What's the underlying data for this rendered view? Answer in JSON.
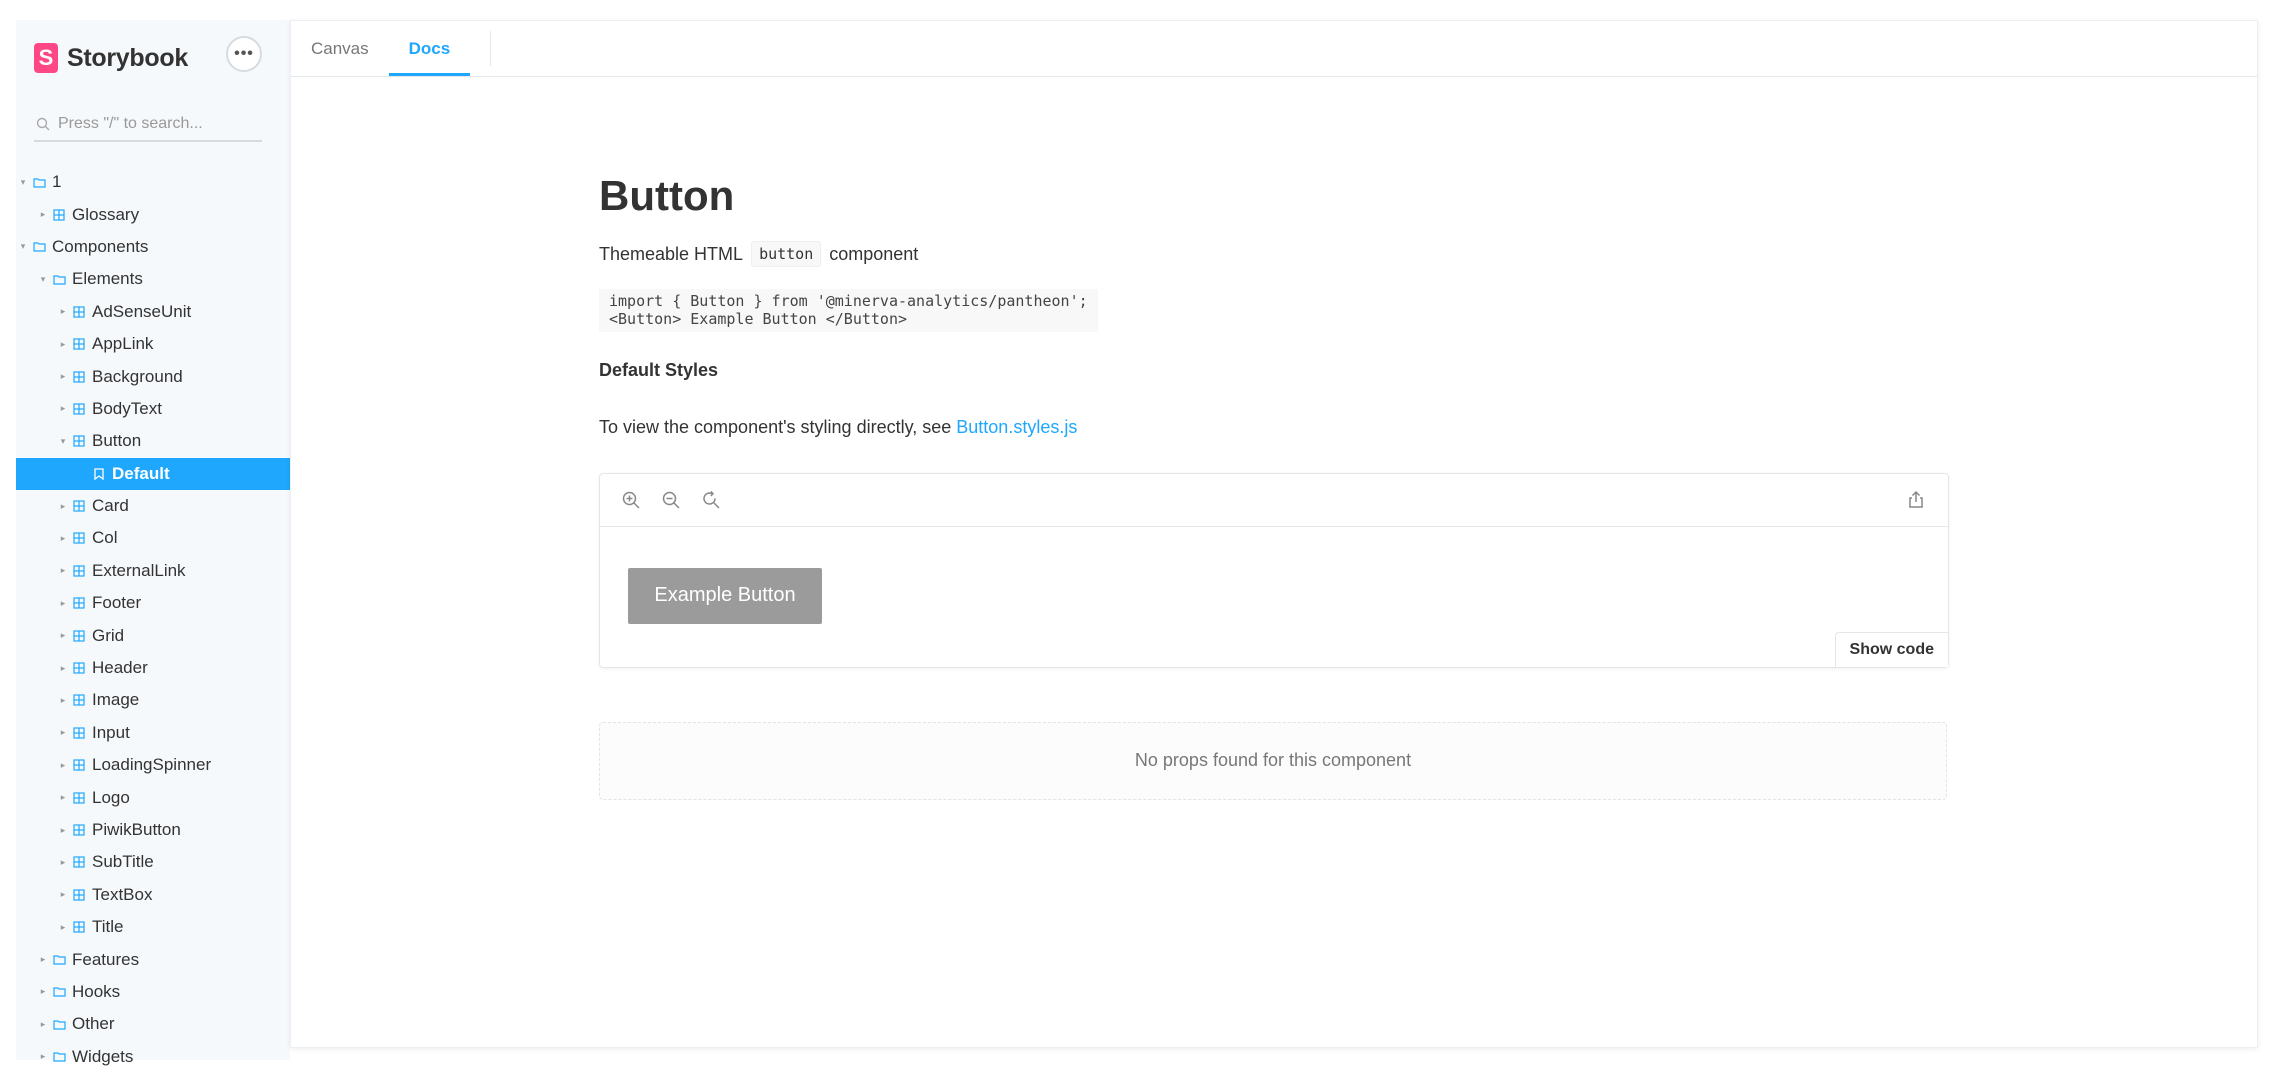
{
  "brand": {
    "logo_letter": "S",
    "name": "Storybook"
  },
  "menu_button_label": "•••",
  "search": {
    "placeholder": "Press \"/\" to search..."
  },
  "tree": [
    {
      "label": "1",
      "depth": 0,
      "type": "folder",
      "expanded": true
    },
    {
      "label": "Glossary",
      "depth": 1,
      "type": "component",
      "expanded": false
    },
    {
      "label": "Components",
      "depth": 0,
      "type": "folder",
      "expanded": true
    },
    {
      "label": "Elements",
      "depth": 1,
      "type": "folder",
      "expanded": true
    },
    {
      "label": "AdSenseUnit",
      "depth": 2,
      "type": "component",
      "expanded": false
    },
    {
      "label": "AppLink",
      "depth": 2,
      "type": "component",
      "expanded": false
    },
    {
      "label": "Background",
      "depth": 2,
      "type": "component",
      "expanded": false
    },
    {
      "label": "BodyText",
      "depth": 2,
      "type": "component",
      "expanded": false
    },
    {
      "label": "Button",
      "depth": 2,
      "type": "component",
      "expanded": true
    },
    {
      "label": "Default",
      "depth": 3,
      "type": "story",
      "selected": true
    },
    {
      "label": "Card",
      "depth": 2,
      "type": "component",
      "expanded": false
    },
    {
      "label": "Col",
      "depth": 2,
      "type": "component",
      "expanded": false
    },
    {
      "label": "ExternalLink",
      "depth": 2,
      "type": "component",
      "expanded": false
    },
    {
      "label": "Footer",
      "depth": 2,
      "type": "component",
      "expanded": false
    },
    {
      "label": "Grid",
      "depth": 2,
      "type": "component",
      "expanded": false
    },
    {
      "label": "Header",
      "depth": 2,
      "type": "component",
      "expanded": false
    },
    {
      "label": "Image",
      "depth": 2,
      "type": "component",
      "expanded": false
    },
    {
      "label": "Input",
      "depth": 2,
      "type": "component",
      "expanded": false
    },
    {
      "label": "LoadingSpinner",
      "depth": 2,
      "type": "component",
      "expanded": false
    },
    {
      "label": "Logo",
      "depth": 2,
      "type": "component",
      "expanded": false
    },
    {
      "label": "PiwikButton",
      "depth": 2,
      "type": "component",
      "expanded": false
    },
    {
      "label": "SubTitle",
      "depth": 2,
      "type": "component",
      "expanded": false
    },
    {
      "label": "TextBox",
      "depth": 2,
      "type": "component",
      "expanded": false
    },
    {
      "label": "Title",
      "depth": 2,
      "type": "component",
      "expanded": false
    },
    {
      "label": "Features",
      "depth": 1,
      "type": "folder",
      "expanded": false
    },
    {
      "label": "Hooks",
      "depth": 1,
      "type": "folder",
      "expanded": false
    },
    {
      "label": "Other",
      "depth": 1,
      "type": "folder",
      "expanded": false
    },
    {
      "label": "Widgets",
      "depth": 1,
      "type": "folder",
      "expanded": false
    }
  ],
  "tabs": {
    "canvas": "Canvas",
    "docs": "Docs",
    "active": "docs"
  },
  "docs": {
    "title": "Button",
    "desc_before": "Themeable HTML",
    "desc_code": "button",
    "desc_after": "component",
    "code_line_1": "import { Button } from '@minerva-analytics/pantheon';",
    "code_line_2": "<Button> Example Button </Button>",
    "section_title": "Default Styles",
    "link_prefix": "To view the component's styling directly, see",
    "link_text": "Button.styles.js",
    "example_button_label": "Example Button",
    "show_code_label": "Show code",
    "no_props_text": "No props found for this component"
  },
  "colors": {
    "accent": "#1ea7fd",
    "brand": "#ff4785",
    "sidebar_bg": "#f6f9fc",
    "example_button_bg": "#9b9b9b"
  },
  "icons": {
    "folder": "folder-icon",
    "component": "component-icon",
    "story": "bookmark-icon",
    "zoom_in": "zoom-in-icon",
    "zoom_out": "zoom-out-icon",
    "zoom_reset": "zoom-reset-icon",
    "share": "share-icon",
    "search": "search-icon"
  }
}
